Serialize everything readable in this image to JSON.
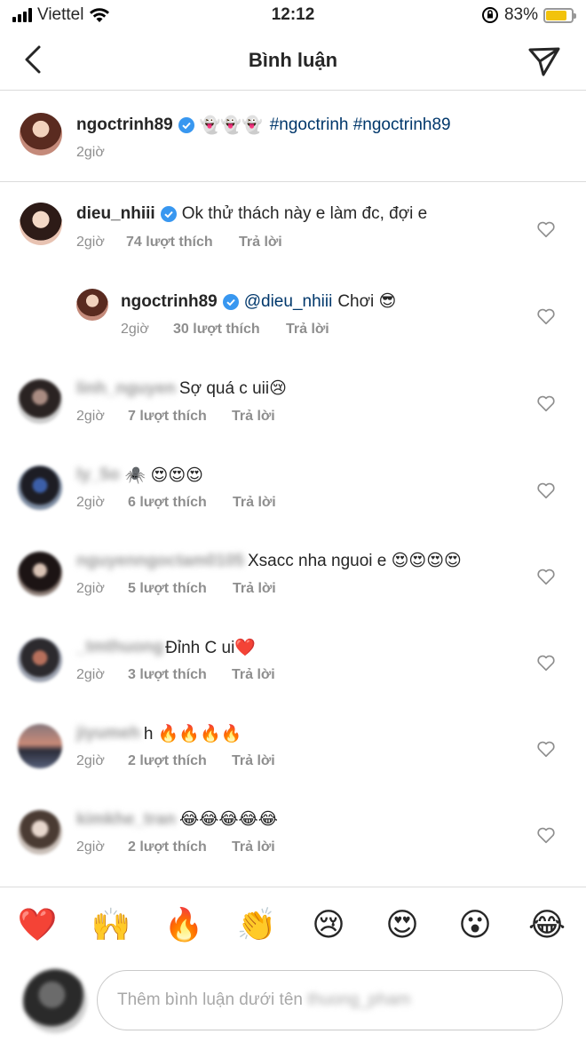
{
  "status_bar": {
    "carrier": "Viettel",
    "time": "12:12",
    "battery_percent": "83%",
    "battery_level": 0.83,
    "icons": [
      "signal-icon",
      "wifi-icon",
      "orientation-lock-icon",
      "battery-icon"
    ]
  },
  "header": {
    "title": "Bình luận",
    "back_icon": "back-chevron-icon",
    "send_icon": "direct-send-icon"
  },
  "caption": {
    "username": "ngoctrinh89",
    "verified": true,
    "ghosts": "👻👻👻",
    "hashtags": "#ngoctrinh #ngoctrinh89",
    "time": "2giờ"
  },
  "comments": [
    {
      "username": "dieu_nhiii",
      "verified": true,
      "text": "Ok thử thách này e làm đc, đợi e",
      "time": "2giờ",
      "likes": "74 lượt thích",
      "reply": "Trả lời"
    },
    {
      "username": "ngoctrinh89",
      "verified": true,
      "mention": "@dieu_nhiii",
      "text": "Chơi 😎",
      "time": "2giờ",
      "likes": "30 lượt thích",
      "reply": "Trả lời"
    },
    {
      "username": "linh_nguyen",
      "text": "Sợ quá c uii😢",
      "time": "2giờ",
      "likes": "7 lượt thích",
      "reply": "Trả lời"
    },
    {
      "username": "ly_5o",
      "text": "🕷️ 😍😍😍",
      "time": "2giờ",
      "likes": "6 lượt thích",
      "reply": "Trả lời"
    },
    {
      "username": "nguyenngoctam0105",
      "text": "Xsacc nha nguoi e 😍😍😍😍",
      "time": "2giờ",
      "likes": "5 lượt thích",
      "reply": "Trả lời"
    },
    {
      "username": "_tmthuong",
      "text": "Đỉnh C ui❤️",
      "time": "2giờ",
      "likes": "3 lượt thích",
      "reply": "Trả lời"
    },
    {
      "username": "jiyumeh",
      "text": "h 🔥🔥🔥🔥",
      "time": "2giờ",
      "likes": "2 lượt thích",
      "reply": "Trả lời"
    },
    {
      "username": "kimkhe_tran",
      "text": "😂😂😂😂😂",
      "time": "2giờ",
      "likes": "2 lượt thích",
      "reply": "Trả lời"
    }
  ],
  "emoji_bar": [
    "❤️",
    "🙌",
    "🔥",
    "👏",
    "😢",
    "😍",
    "😮",
    "😂"
  ],
  "composer": {
    "placeholder": "Thêm bình luận dưới tên",
    "placeholder_user": "thuong_pham"
  }
}
